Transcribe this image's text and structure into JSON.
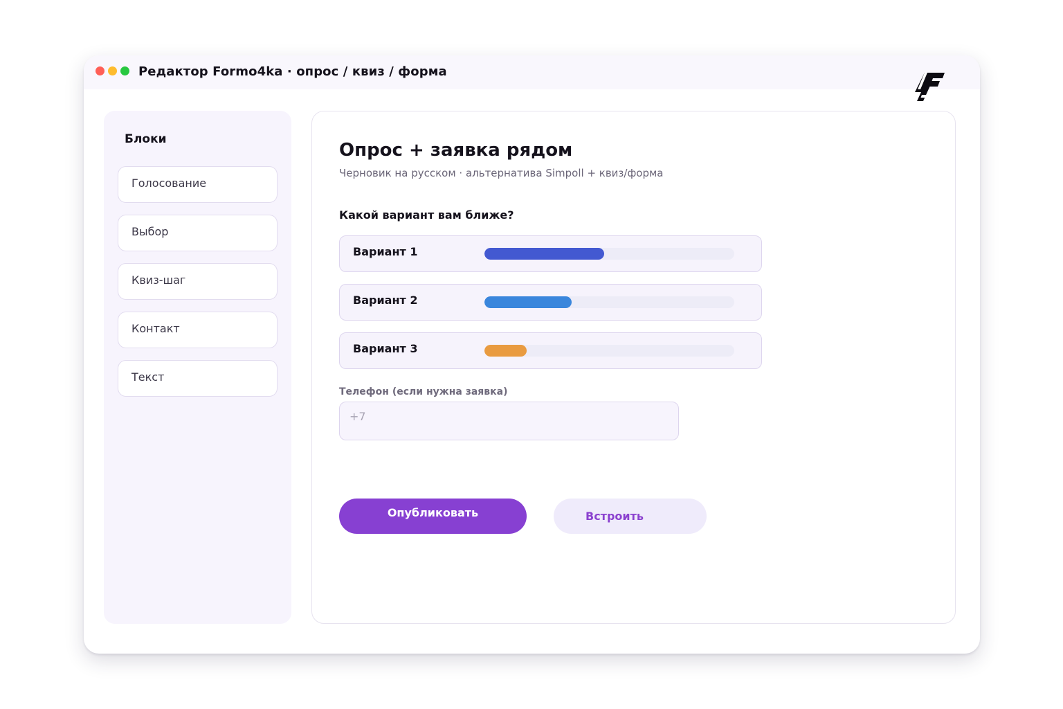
{
  "window": {
    "title": "Редактор Formo4ka · опрос / квиз / форма"
  },
  "sidebar": {
    "title": "Блоки",
    "items": [
      {
        "label": "Голосование"
      },
      {
        "label": "Выбор"
      },
      {
        "label": "Квиз-шаг"
      },
      {
        "label": "Контакт"
      },
      {
        "label": "Текст"
      }
    ]
  },
  "main": {
    "title": "Опрос + заявка рядом",
    "subtitle": "Черновик на русском · альтернатива Simpoll + квиз/форма",
    "question": "Какой вариант вам ближе?",
    "options": [
      {
        "label": "Вариант 1",
        "share": 0.48,
        "color": "#4359d1"
      },
      {
        "label": "Вариант 2",
        "share": 0.35,
        "color": "#3a86dc"
      },
      {
        "label": "Вариант 3",
        "share": 0.17,
        "color": "#e99b40"
      }
    ],
    "phone": {
      "label": "Телефон (если нужна заявка)",
      "placeholder": "+7",
      "value": ""
    },
    "actions": {
      "publish_label": "Опубликовать",
      "embed_label": "Встроить"
    }
  },
  "colors": {
    "accent": "#8740d2",
    "accent_soft": "#efebfb",
    "panel_bg": "#f7f4fd"
  },
  "icons": {
    "logo": "formo4ka-logo",
    "window_controls": [
      "close-dot",
      "minimize-dot",
      "maximize-dot"
    ]
  }
}
